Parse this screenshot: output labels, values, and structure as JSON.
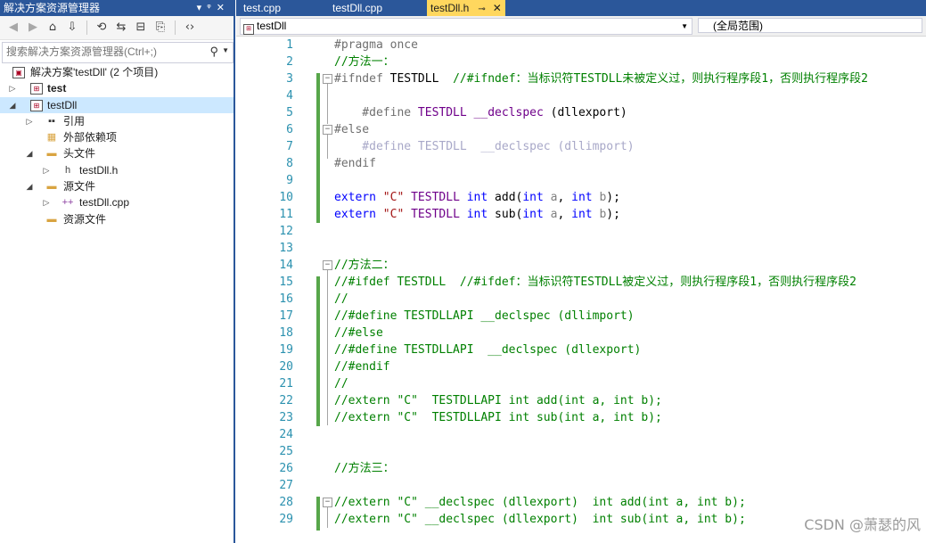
{
  "solution_explorer": {
    "title": "解决方案资源管理器",
    "title_controls": [
      "▾",
      "ᵠ",
      "✕"
    ],
    "toolbar_icons": [
      "back-icon",
      "forward-icon",
      "home-icon",
      "switch-views-icon",
      "history-icon",
      "sync-icon",
      "collapse-icon",
      "properties-icon",
      "code-icon"
    ],
    "search_placeholder": "搜索解决方案资源管理器(Ctrl+;)",
    "tree": [
      {
        "label": "解决方案'testDll' (2 个项目)",
        "icon": "solution-icon"
      },
      {
        "label": "test",
        "icon": "project-icon",
        "bold": true,
        "expander": "▷"
      },
      {
        "label": "testDll",
        "icon": "project-icon",
        "bold": false,
        "expander": "◢",
        "selected": true
      },
      {
        "label": "引用",
        "icon": "references-icon",
        "expander": "▷"
      },
      {
        "label": "外部依赖项",
        "icon": "external-deps-icon"
      },
      {
        "label": "头文件",
        "icon": "folder-icon",
        "expander": "◢"
      },
      {
        "label": "testDll.h",
        "icon": "header-file-icon",
        "expander": "▷"
      },
      {
        "label": "源文件",
        "icon": "folder-icon",
        "expander": "◢"
      },
      {
        "label": "testDll.cpp",
        "icon": "cpp-file-icon",
        "expander": "▷"
      },
      {
        "label": "资源文件",
        "icon": "folder-icon"
      }
    ]
  },
  "tabs": [
    {
      "label": "test.cpp",
      "active": false
    },
    {
      "label": "testDll.cpp",
      "active": false
    },
    {
      "label": "testDll.h",
      "active": true,
      "pin": "⊸",
      "close": "✕"
    }
  ],
  "navbar": {
    "scope_left": "testDll",
    "scope_right": "(全局范围)"
  },
  "editor": {
    "lines": [
      {
        "n": "1",
        "parts": [
          [
            "pp",
            "#pragma once"
          ]
        ]
      },
      {
        "n": "2",
        "parts": [
          [
            "cm",
            "//方法一："
          ]
        ]
      },
      {
        "n": "3",
        "parts": [
          [
            "pp",
            "#ifndef "
          ],
          [
            "",
            "TESTDLL  "
          ],
          [
            "cm",
            "//#ifndef：当标识符TESTDLL未被定义过，则执行程序段1，否则执行程序段2"
          ]
        ]
      },
      {
        "n": "4",
        "parts": []
      },
      {
        "n": "5",
        "parts": [
          [
            "pp",
            "    #define "
          ],
          [
            "mc",
            "TESTDLL __declspec"
          ],
          [
            "",
            " (dllexport)"
          ]
        ]
      },
      {
        "n": "6",
        "parts": [
          [
            "pp",
            "#else"
          ]
        ]
      },
      {
        "n": "7",
        "parts": [
          [
            "gr",
            "    #define TESTDLL  __declspec (dllimport)"
          ]
        ]
      },
      {
        "n": "8",
        "parts": [
          [
            "pp",
            "#endif"
          ]
        ]
      },
      {
        "n": "9",
        "parts": []
      },
      {
        "n": "10",
        "parts": [
          [
            "kw",
            "extern "
          ],
          [
            "st",
            "\"C\" "
          ],
          [
            "mc",
            "TESTDLL "
          ],
          [
            "kw",
            "int "
          ],
          [
            "",
            "add("
          ],
          [
            "kw",
            "int "
          ],
          [
            "pa",
            "a"
          ],
          [
            "",
            ", "
          ],
          [
            "kw",
            "int "
          ],
          [
            "pa",
            "b"
          ],
          [
            "",
            ");"
          ]
        ]
      },
      {
        "n": "11",
        "parts": [
          [
            "kw",
            "extern "
          ],
          [
            "st",
            "\"C\" "
          ],
          [
            "mc",
            "TESTDLL "
          ],
          [
            "kw",
            "int "
          ],
          [
            "",
            "sub("
          ],
          [
            "kw",
            "int "
          ],
          [
            "pa",
            "a"
          ],
          [
            "",
            ", "
          ],
          [
            "kw",
            "int "
          ],
          [
            "pa",
            "b"
          ],
          [
            "",
            ");"
          ]
        ]
      },
      {
        "n": "12",
        "parts": []
      },
      {
        "n": "13",
        "parts": []
      },
      {
        "n": "14",
        "parts": [
          [
            "cm",
            "//方法二："
          ]
        ]
      },
      {
        "n": "15",
        "parts": [
          [
            "cm",
            "//#ifdef TESTDLL  //#ifdef：当标识符TESTDLL被定义过，则执行程序段1，否则执行程序段2"
          ]
        ]
      },
      {
        "n": "16",
        "parts": [
          [
            "cm",
            "//"
          ]
        ]
      },
      {
        "n": "17",
        "parts": [
          [
            "cm",
            "//#define TESTDLLAPI __declspec (dllimport)"
          ]
        ]
      },
      {
        "n": "18",
        "parts": [
          [
            "cm",
            "//#else"
          ]
        ]
      },
      {
        "n": "19",
        "parts": [
          [
            "cm",
            "//#define TESTDLLAPI  __declspec (dllexport)"
          ]
        ]
      },
      {
        "n": "20",
        "parts": [
          [
            "cm",
            "//#endif"
          ]
        ]
      },
      {
        "n": "21",
        "parts": [
          [
            "cm",
            "//"
          ]
        ]
      },
      {
        "n": "22",
        "parts": [
          [
            "cm",
            "//extern \"C\"  TESTDLLAPI int add(int a, int b);"
          ]
        ]
      },
      {
        "n": "23",
        "parts": [
          [
            "cm",
            "//extern \"C\"  TESTDLLAPI int sub(int a, int b);"
          ]
        ]
      },
      {
        "n": "24",
        "parts": []
      },
      {
        "n": "25",
        "parts": []
      },
      {
        "n": "26",
        "parts": [
          [
            "cm",
            "//方法三："
          ]
        ]
      },
      {
        "n": "27",
        "parts": []
      },
      {
        "n": "28",
        "parts": [
          [
            "cm",
            "//extern \"C\" __declspec (dllexport)  int add(int a, int b);"
          ]
        ]
      },
      {
        "n": "29",
        "parts": [
          [
            "cm",
            "//extern \"C\" __declspec (dllexport)  int sub(int a, int b);"
          ]
        ]
      }
    ]
  },
  "watermark": "CSDN @萧瑟的风",
  "colors": {
    "accent": "#2b579a",
    "active_tab": "#ffd75e",
    "line_number": "#2b91af",
    "change_marker": "#57a64a",
    "selection": "#cce8ff"
  }
}
